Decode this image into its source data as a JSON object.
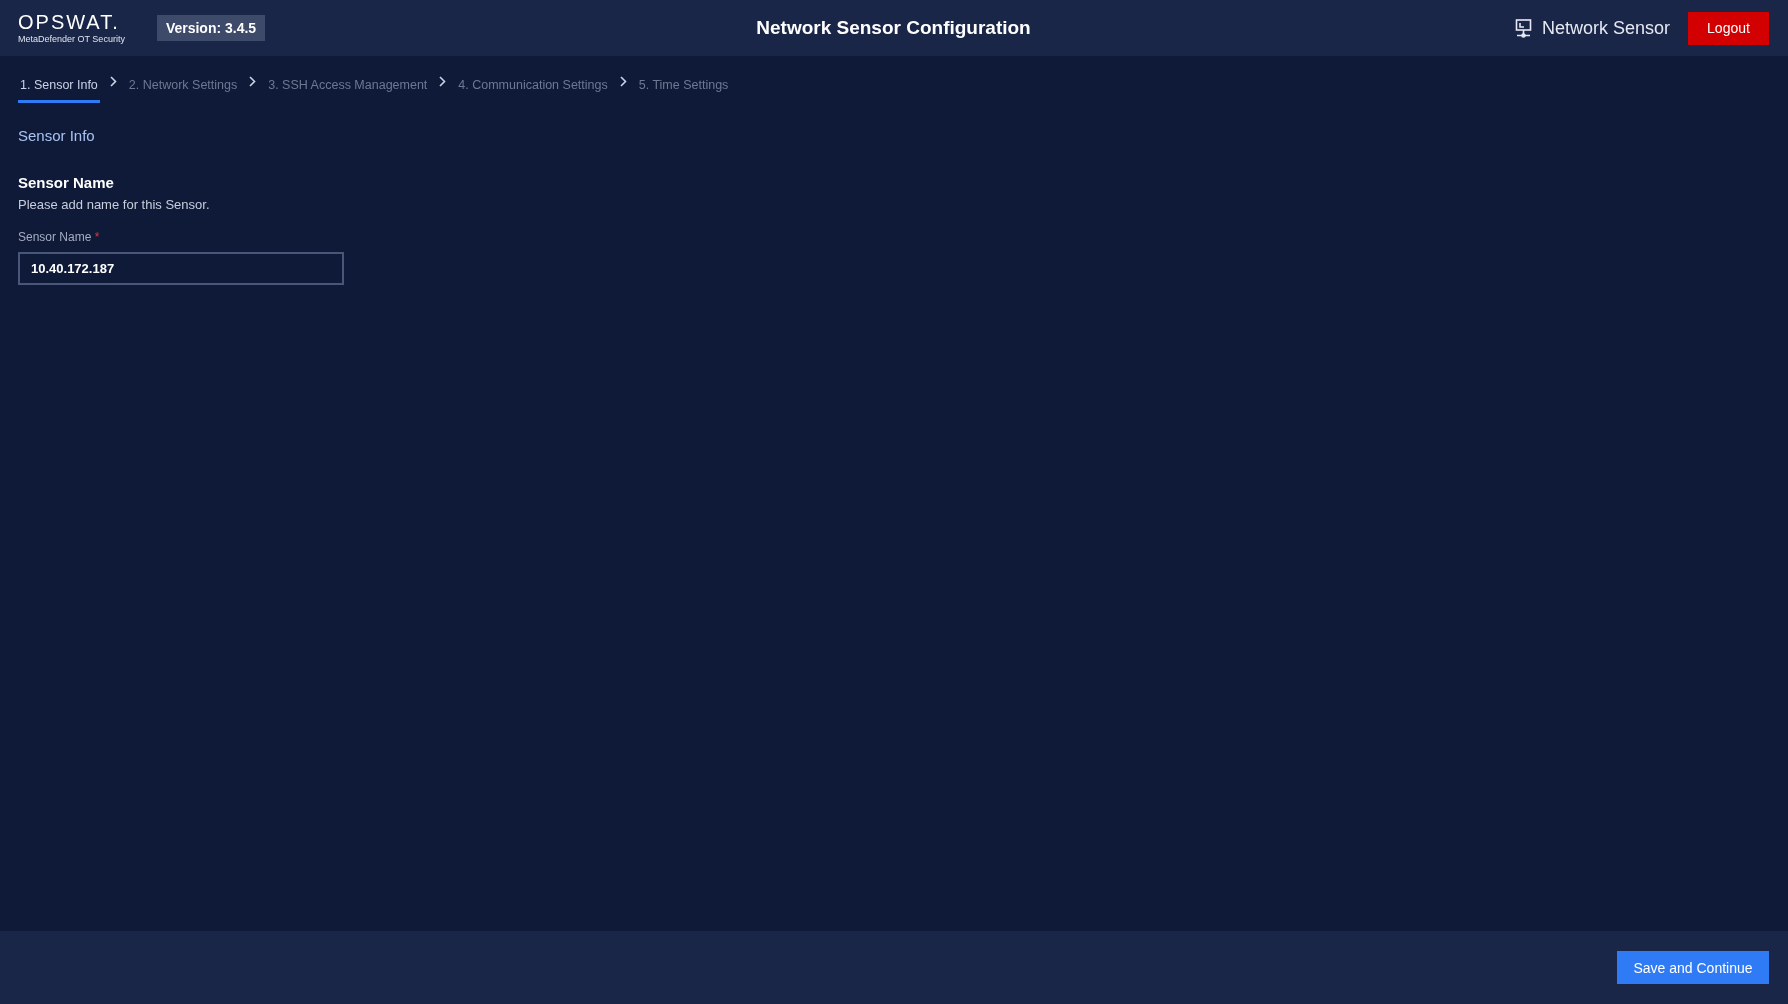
{
  "brand": {
    "logo": "OPSWAT.",
    "product": "MetaDefender OT Security"
  },
  "version": "Version: 3.4.5",
  "title": "Network Sensor Configuration",
  "user": {
    "label": "Network Sensor"
  },
  "logout": "Logout",
  "steps": [
    {
      "label": "1. Sensor Info",
      "selected": true
    },
    {
      "label": "2. Network Settings",
      "selected": false
    },
    {
      "label": "3. SSH Access Management",
      "selected": false
    },
    {
      "label": "4. Communication Settings",
      "selected": false
    },
    {
      "label": "5. Time Settings",
      "selected": false
    }
  ],
  "section_title": "Sensor Info",
  "field_group": {
    "heading": "Sensor Name",
    "description": "Please add name for this Sensor.",
    "label": "Sensor Name",
    "required_mark": "*",
    "value": "10.40.172.187"
  },
  "footer": {
    "primary_button": "Save and Continue"
  }
}
